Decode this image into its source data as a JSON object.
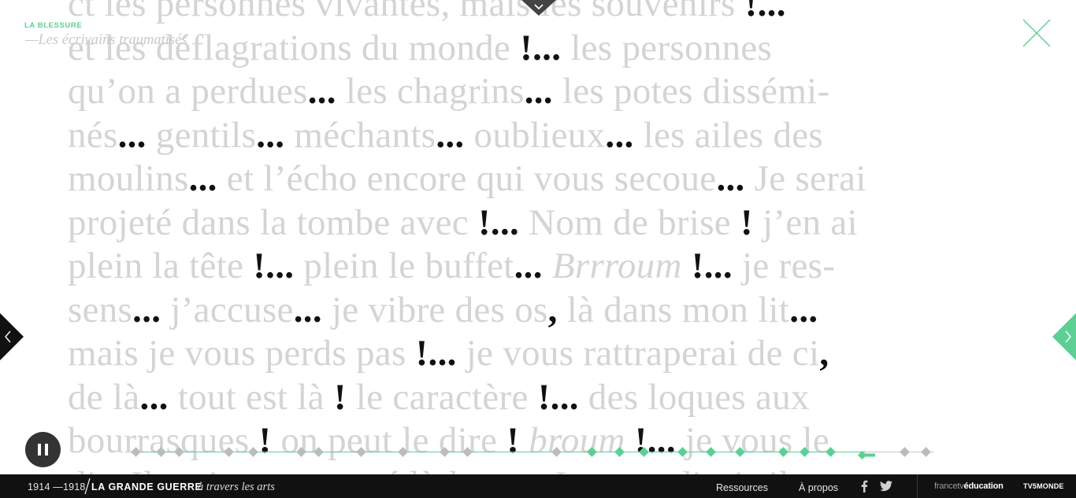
{
  "chapter": {
    "tag": "LA BLESSURE",
    "subtitle": "—Les écrivains traumatisés"
  },
  "page_text": {
    "lines": [
      {
        "segments": [
          {
            "t": "ct les personnes vivantes, mais les souvenirs ",
            "s": "plain"
          },
          {
            "t": "!...",
            "s": "mark"
          }
        ]
      },
      {
        "segments": [
          {
            "t": "et les déflagrations du monde ",
            "s": "plain"
          },
          {
            "t": "!...",
            "s": "mark"
          },
          {
            "t": " les personnes",
            "s": "plain"
          }
        ]
      },
      {
        "segments": [
          {
            "t": "qu’on a perdues",
            "s": "plain"
          },
          {
            "t": "...",
            "s": "mark"
          },
          {
            "t": " les chagrins",
            "s": "plain"
          },
          {
            "t": "...",
            "s": "mark"
          },
          {
            "t": " les potes dissémi-",
            "s": "plain"
          }
        ]
      },
      {
        "segments": [
          {
            "t": "nés",
            "s": "plain"
          },
          {
            "t": "...",
            "s": "mark"
          },
          {
            "t": " gentils",
            "s": "plain"
          },
          {
            "t": "...",
            "s": "mark"
          },
          {
            "t": " méchants",
            "s": "plain"
          },
          {
            "t": "...",
            "s": "mark"
          },
          {
            "t": " oublieux",
            "s": "plain"
          },
          {
            "t": "...",
            "s": "mark"
          },
          {
            "t": " les ailes des",
            "s": "plain"
          }
        ]
      },
      {
        "segments": [
          {
            "t": "moulins",
            "s": "plain"
          },
          {
            "t": "...",
            "s": "mark"
          },
          {
            "t": " et l’écho encore qui vous secoue",
            "s": "plain"
          },
          {
            "t": "...",
            "s": "mark"
          },
          {
            "t": " Je serai",
            "s": "plain"
          }
        ]
      },
      {
        "segments": [
          {
            "t": "projeté dans la tombe avec ",
            "s": "plain"
          },
          {
            "t": "!...",
            "s": "mark"
          },
          {
            "t": " Nom de brise ",
            "s": "plain"
          },
          {
            "t": "!",
            "s": "mark"
          },
          {
            "t": " j’en ai",
            "s": "plain"
          }
        ]
      },
      {
        "segments": [
          {
            "t": "plein la tête ",
            "s": "plain"
          },
          {
            "t": "!...",
            "s": "mark"
          },
          {
            "t": " plein le buffet",
            "s": "plain"
          },
          {
            "t": "...",
            "s": "mark"
          },
          {
            "t": " ",
            "s": "plain"
          },
          {
            "t": "Brrroum",
            "s": "italic"
          },
          {
            "t": " ",
            "s": "plain"
          },
          {
            "t": "!...",
            "s": "mark"
          },
          {
            "t": " je res-",
            "s": "plain"
          }
        ]
      },
      {
        "segments": [
          {
            "t": "sens",
            "s": "plain"
          },
          {
            "t": "...",
            "s": "mark"
          },
          {
            "t": " j’accuse",
            "s": "plain"
          },
          {
            "t": "...",
            "s": "mark"
          },
          {
            "t": " je vibre des os",
            "s": "plain"
          },
          {
            "t": ",",
            "s": "mark"
          },
          {
            "t": " là dans mon lit",
            "s": "plain"
          },
          {
            "t": "...",
            "s": "mark"
          }
        ]
      },
      {
        "segments": [
          {
            "t": "mais je vous perds pas ",
            "s": "plain"
          },
          {
            "t": "!...",
            "s": "mark"
          },
          {
            "t": " je vous rattraperai de ci",
            "s": "plain"
          },
          {
            "t": ",",
            "s": "mark"
          }
        ]
      },
      {
        "segments": [
          {
            "t": "de là",
            "s": "plain"
          },
          {
            "t": "...",
            "s": "mark"
          },
          {
            "t": " tout est là ",
            "s": "plain"
          },
          {
            "t": "!",
            "s": "mark"
          },
          {
            "t": " le caractère ",
            "s": "plain"
          },
          {
            "t": "!...",
            "s": "mark"
          },
          {
            "t": " des loques aux",
            "s": "plain"
          }
        ]
      },
      {
        "segments": [
          {
            "t": "bourrasques ",
            "s": "plain"
          },
          {
            "t": "!",
            "s": "mark"
          },
          {
            "t": " on peut le dire ",
            "s": "plain"
          },
          {
            "t": "!",
            "s": "mark"
          },
          {
            "t": " ",
            "s": "plain"
          },
          {
            "t": "broum",
            "s": "italic"
          },
          {
            "t": " ",
            "s": "plain"
          },
          {
            "t": "!...",
            "s": "mark"
          },
          {
            "t": " je vous le",
            "s": "plain"
          }
        ]
      },
      {
        "segments": [
          {
            "t": "dis. Ils m’ont remonté là-haut",
            "s": "plain"
          },
          {
            "t": "...",
            "s": "mark"
          },
          {
            "t": " Je vous disais ils",
            "s": "plain"
          }
        ]
      }
    ]
  },
  "timeline": {
    "dots": [
      {
        "pos": 0.006,
        "active": false
      },
      {
        "pos": 0.037,
        "active": false
      },
      {
        "pos": 0.06,
        "active": false
      },
      {
        "pos": 0.122,
        "active": false
      },
      {
        "pos": 0.152,
        "active": false
      },
      {
        "pos": 0.212,
        "active": false
      },
      {
        "pos": 0.233,
        "active": false
      },
      {
        "pos": 0.286,
        "active": false
      },
      {
        "pos": 0.338,
        "active": false
      },
      {
        "pos": 0.39,
        "active": false
      },
      {
        "pos": 0.419,
        "active": false
      },
      {
        "pos": 0.529,
        "active": false
      },
      {
        "pos": 0.574,
        "active": true
      },
      {
        "pos": 0.608,
        "active": true
      },
      {
        "pos": 0.638,
        "active": true
      },
      {
        "pos": 0.686,
        "active": true
      },
      {
        "pos": 0.722,
        "active": true
      },
      {
        "pos": 0.758,
        "active": true
      },
      {
        "pos": 0.812,
        "active": true
      },
      {
        "pos": 0.838,
        "active": true
      },
      {
        "pos": 0.871,
        "active": true
      },
      {
        "pos": 0.963,
        "active": false
      },
      {
        "pos": 0.989,
        "active": false
      }
    ],
    "current_pos": 0.915,
    "progress": 0.915
  },
  "footer": {
    "dates": "1914 —1918",
    "brand": "LA GRANDE GUERRE",
    "brand_tail": "à travers les arts",
    "links": [
      "Ressources",
      "À propos"
    ],
    "logo_fe_light": "francetv",
    "logo_fe_bold": "éducation",
    "logo_tv": "TV5MONDE"
  },
  "colors": {
    "accent": "#5ccf95",
    "footer_bg": "#111111",
    "text_faded": "#d4d4d4",
    "text_mark": "#111111"
  },
  "icons": {
    "top_toggle": "chevron-down-icon",
    "close": "close-icon",
    "prev": "chevron-left-icon",
    "next": "chevron-right-icon",
    "pause": "pause-icon",
    "facebook": "facebook-icon",
    "twitter": "twitter-icon"
  }
}
